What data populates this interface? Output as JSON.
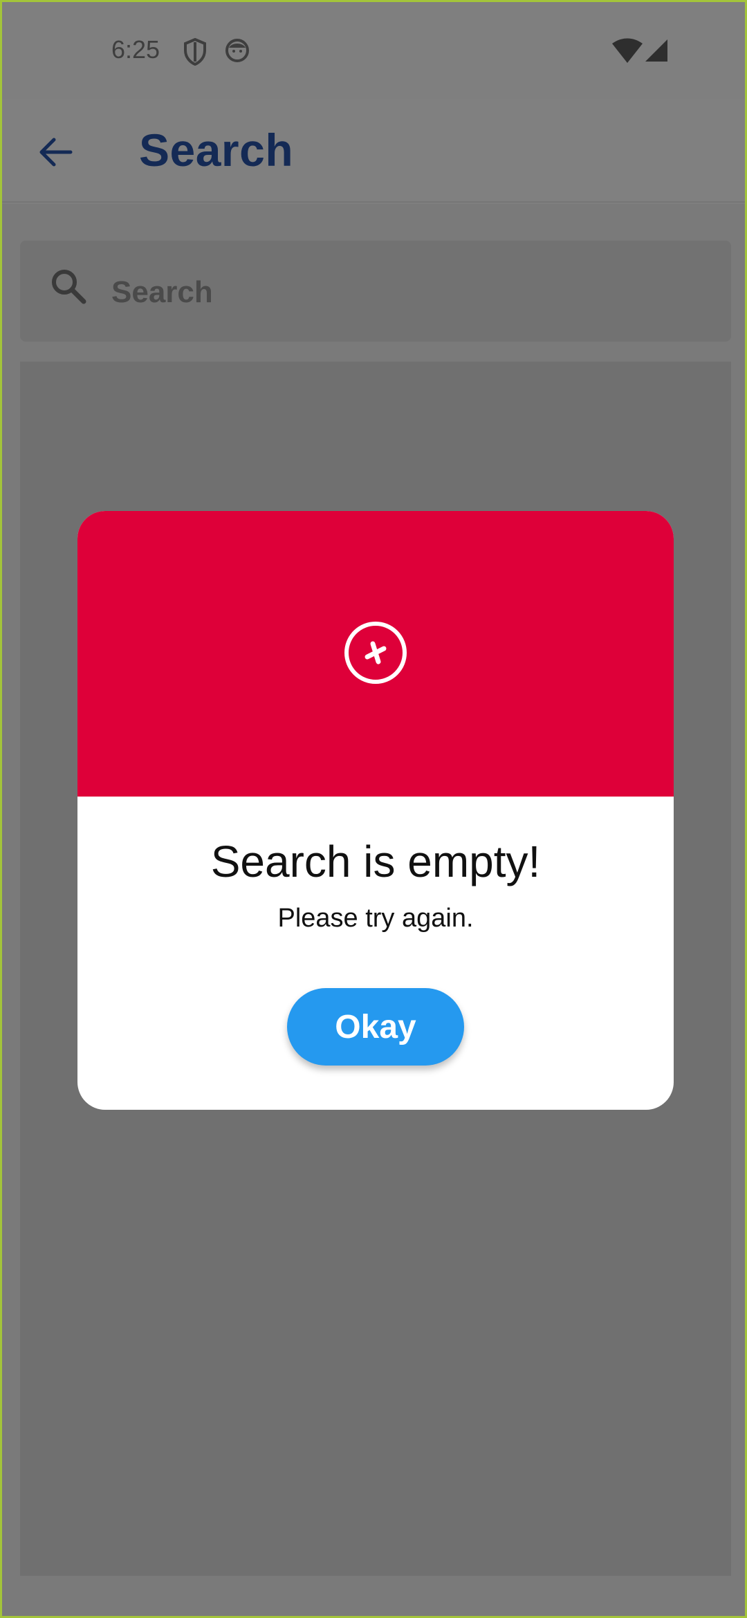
{
  "status_bar": {
    "time": "6:25",
    "icons": [
      "shield-icon",
      "face-icon",
      "wifi-icon",
      "signal-icon"
    ]
  },
  "app_bar": {
    "back_icon": "arrow-left-icon",
    "title": "Search"
  },
  "search": {
    "placeholder": "Search",
    "value": "",
    "icon": "search-icon"
  },
  "dialog": {
    "header_color": "#de0039",
    "icon": "error-x-circle-icon",
    "title": "Search is empty!",
    "message": "Please try again.",
    "button_label": "Okay",
    "button_color": "#2599ef"
  },
  "colors": {
    "title_text": "#142a55",
    "frame_border": "#a3c43a"
  }
}
